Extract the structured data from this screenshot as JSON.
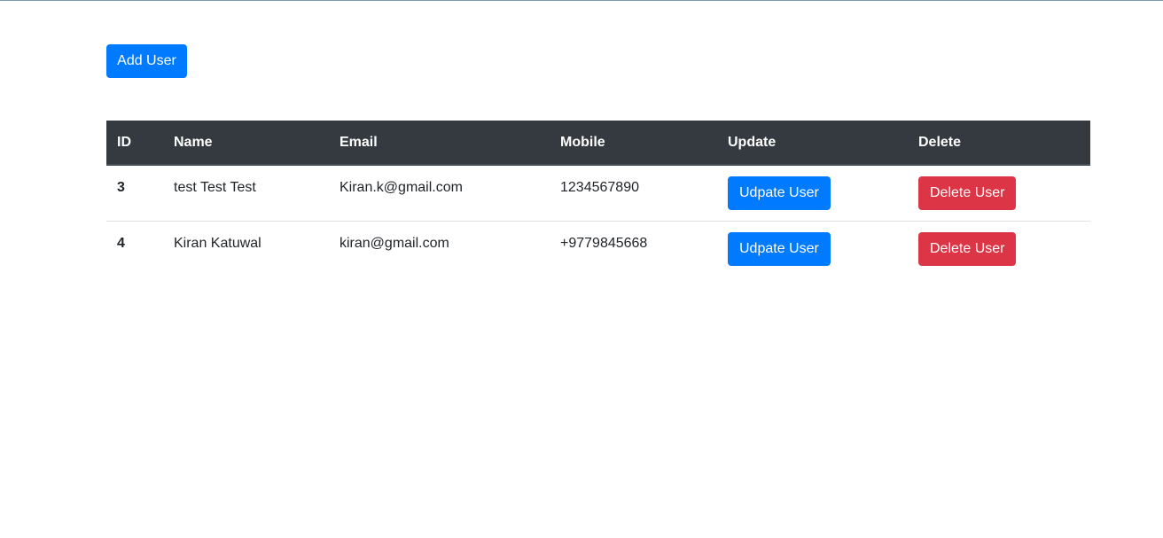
{
  "toolbar": {
    "add_user_label": "Add User"
  },
  "table": {
    "headers": {
      "id": "ID",
      "name": "Name",
      "email": "Email",
      "mobile": "Mobile",
      "update": "Update",
      "delete": "Delete"
    },
    "rows": [
      {
        "id": "3",
        "name": "test Test Test",
        "email": "Kiran.k@gmail.com",
        "mobile": "1234567890",
        "update_label": "Udpate User",
        "delete_label": "Delete User"
      },
      {
        "id": "4",
        "name": "Kiran Katuwal",
        "email": "kiran@gmail.com",
        "mobile": "+9779845668",
        "update_label": "Udpate User",
        "delete_label": "Delete User"
      }
    ]
  },
  "colors": {
    "primary": "#007bff",
    "danger": "#dc3545",
    "header_bg": "#343a40"
  }
}
